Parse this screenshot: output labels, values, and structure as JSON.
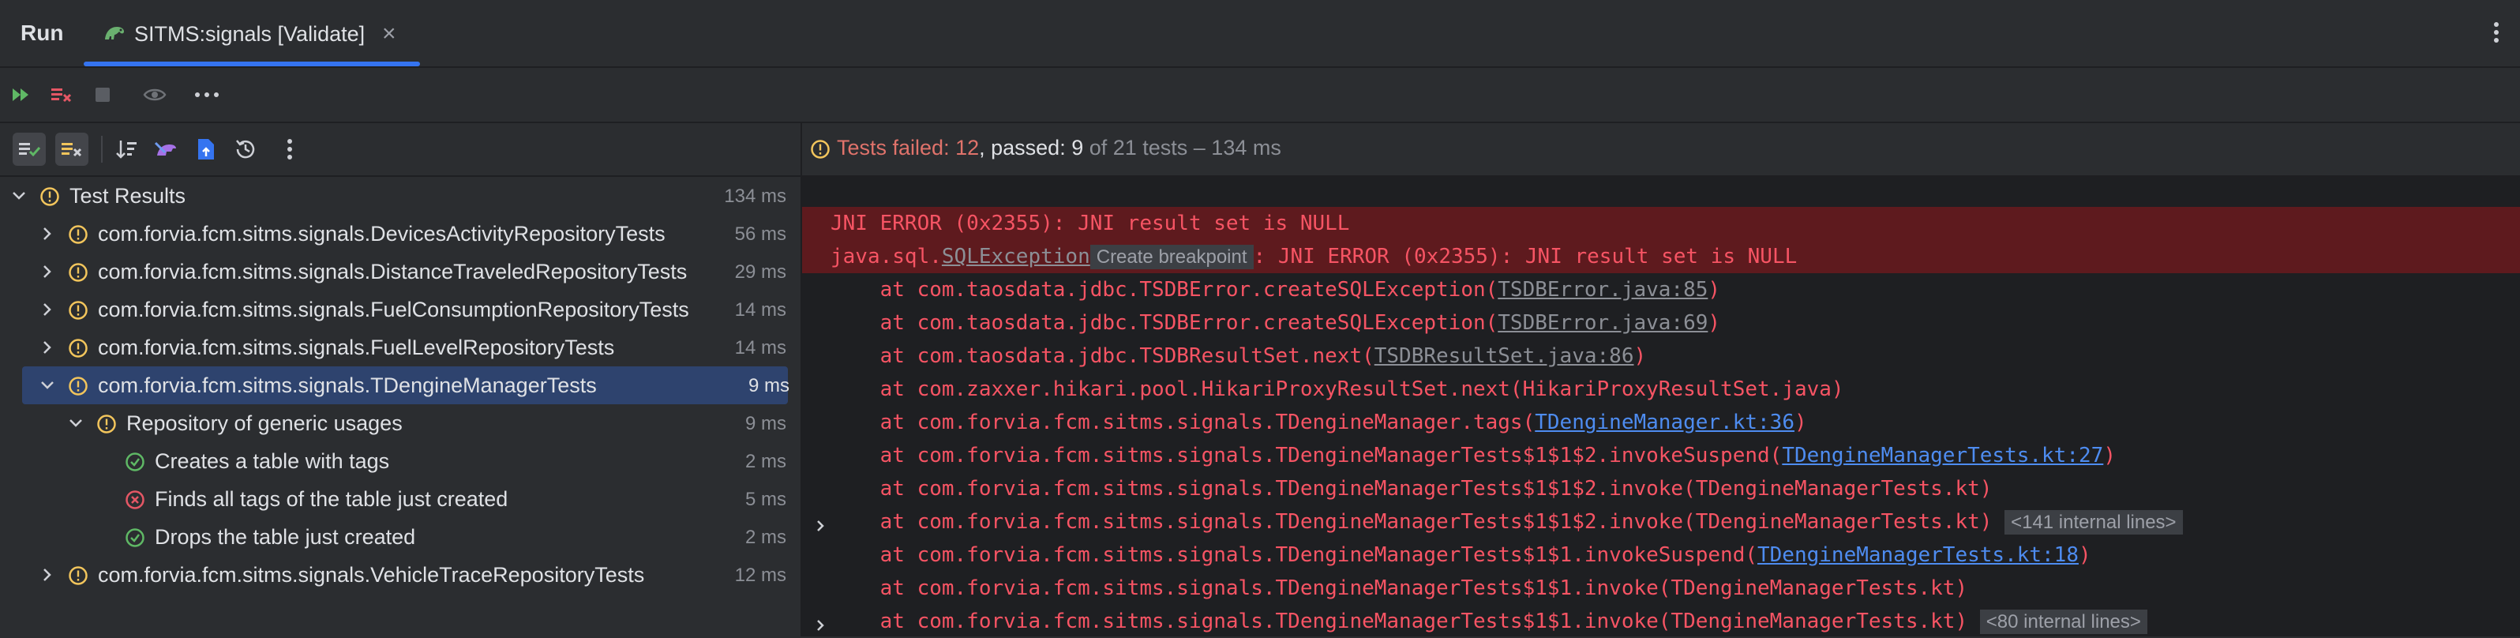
{
  "header": {
    "run_label": "Run",
    "tab_label": "SITMS:signals [Validate]",
    "tab_close": "×"
  },
  "summary": {
    "failed_label": "Tests failed: 12",
    "separator": ", ",
    "passed_label": "passed: 9",
    "rest": " of 21 tests – 134 ms"
  },
  "tree": [
    {
      "label": "Test Results",
      "duration": "134 ms",
      "status": "warning",
      "expanded": true,
      "level": 0
    },
    {
      "label": "com.forvia.fcm.sitms.signals.DevicesActivityRepositoryTests",
      "duration": "56 ms",
      "status": "warning",
      "expanded": false,
      "level": 1
    },
    {
      "label": "com.forvia.fcm.sitms.signals.DistanceTraveledRepositoryTests",
      "duration": "29 ms",
      "status": "warning",
      "expanded": false,
      "level": 1
    },
    {
      "label": "com.forvia.fcm.sitms.signals.FuelConsumptionRepositoryTests",
      "duration": "14 ms",
      "status": "warning",
      "expanded": false,
      "level": 1
    },
    {
      "label": "com.forvia.fcm.sitms.signals.FuelLevelRepositoryTests",
      "duration": "14 ms",
      "status": "warning",
      "expanded": false,
      "level": 1
    },
    {
      "label": "com.forvia.fcm.sitms.signals.TDengineManagerTests",
      "duration": "9 ms",
      "status": "warning",
      "expanded": true,
      "level": 1,
      "selected": true
    },
    {
      "label": "Repository of generic usages",
      "duration": "9 ms",
      "status": "warning",
      "expanded": true,
      "level": 2
    },
    {
      "label": "Creates a table with tags",
      "duration": "2 ms",
      "status": "passed",
      "level": 3
    },
    {
      "label": "Finds all tags of the table just created",
      "duration": "5 ms",
      "status": "failed",
      "level": 3
    },
    {
      "label": "Drops the table just created",
      "duration": "2 ms",
      "status": "passed",
      "level": 3
    },
    {
      "label": "com.forvia.fcm.sitms.signals.VehicleTraceRepositoryTests",
      "duration": "12 ms",
      "status": "warning",
      "expanded": false,
      "level": 1
    }
  ],
  "console": {
    "line1": "JNI ERROR (0x2355): JNI result set is NULL",
    "line2_prefix": "java.sql.",
    "line2_link": "SQLException",
    "line2_badge": "Create breakpoint",
    "line2_suffix": ": JNI ERROR (0x2355): JNI result set is NULL",
    "frames": [
      {
        "pre": "    at com.taosdata.jdbc.TSDBError.createSQLException(",
        "link": "TSDBError.java:85",
        "link_type": "gray",
        "post": ")"
      },
      {
        "pre": "    at com.taosdata.jdbc.TSDBError.createSQLException(",
        "link": "TSDBError.java:69",
        "link_type": "gray",
        "post": ")"
      },
      {
        "pre": "    at com.taosdata.jdbc.TSDBResultSet.next(",
        "link": "TSDBResultSet.java:86",
        "link_type": "gray",
        "post": ")"
      },
      {
        "pre": "    at com.zaxxer.hikari.pool.HikariProxyResultSet.next(HikariProxyResultSet.java)",
        "link": "",
        "link_type": "",
        "post": ""
      },
      {
        "pre": "    at com.forvia.fcm.sitms.signals.TDengineManager.tags(",
        "link": "TDengineManager.kt:36",
        "link_type": "blue",
        "post": ")"
      },
      {
        "pre": "    at com.forvia.fcm.sitms.signals.TDengineManagerTests$1$1$2.invokeSuspend(",
        "link": "TDengineManagerTests.kt:27",
        "link_type": "blue",
        "post": ")"
      },
      {
        "pre": "    at com.forvia.fcm.sitms.signals.TDengineManagerTests$1$1$2.invoke(TDengineManagerTests.kt)",
        "link": "",
        "link_type": "",
        "post": ""
      },
      {
        "pre": "    at com.forvia.fcm.sitms.signals.TDengineManagerTests$1$1$2.invoke(TDengineManagerTests.kt)",
        "link": "",
        "link_type": "",
        "post": "",
        "badge": "<141 internal lines>",
        "expandable": true
      },
      {
        "pre": "    at com.forvia.fcm.sitms.signals.TDengineManagerTests$1$1.invokeSuspend(",
        "link": "TDengineManagerTests.kt:18",
        "link_type": "blue",
        "post": ")"
      },
      {
        "pre": "    at com.forvia.fcm.sitms.signals.TDengineManagerTests$1$1.invoke(TDengineManagerTests.kt)",
        "link": "",
        "link_type": "",
        "post": ""
      },
      {
        "pre": "    at com.forvia.fcm.sitms.signals.TDengineManagerTests$1$1.invoke(TDengineManagerTests.kt)",
        "link": "",
        "link_type": "",
        "post": "",
        "badge": "<80 internal lines>",
        "expandable": true
      }
    ]
  },
  "colors": {
    "accent": "#3574f0",
    "error": "#f75464",
    "warning": "#f2c55c",
    "passed": "#5fb865",
    "failed": "#e55765",
    "link": "#4e8cf0"
  },
  "icons": {
    "rerun": "rerun-icon",
    "rerun_failed": "rerun-failed-icon",
    "stop": "stop-icon",
    "eye": "show-icon",
    "more": "more-vertical-icon"
  }
}
